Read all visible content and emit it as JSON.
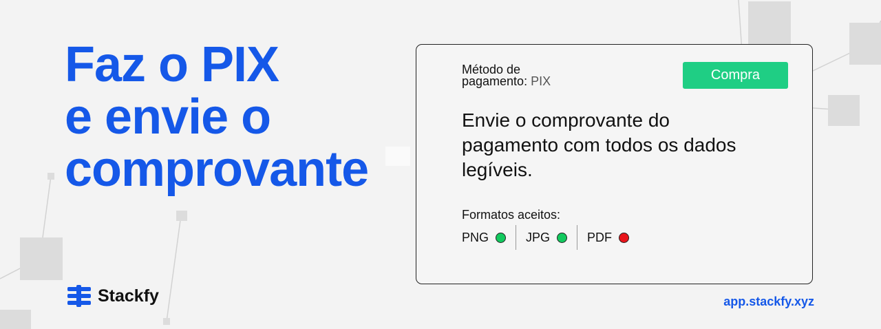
{
  "headline": {
    "line1": "Faz o PIX",
    "line2": "e envie o",
    "line3": "comprovante"
  },
  "brand": {
    "name": "Stackfy",
    "logo_icon": "stack-logo-icon"
  },
  "card": {
    "method_label_1": "Método de",
    "method_label_2": "pagamento:",
    "method_value": "PIX",
    "buy_label": "Compra",
    "instruction": "Envie o comprovante do pagamento com todos os dados legíveis.",
    "formats_label": "Formatos aceitos:",
    "formats": [
      {
        "label": "PNG",
        "status_color": "#12c95e"
      },
      {
        "label": "JPG",
        "status_color": "#12c95e"
      },
      {
        "label": "PDF",
        "status_color": "#e8141b"
      }
    ]
  },
  "footer": {
    "url": "app.stackfy.xyz"
  },
  "colors": {
    "brand_blue": "#1558e8",
    "button_green": "#1fce84",
    "background": "#f3f3f3"
  }
}
